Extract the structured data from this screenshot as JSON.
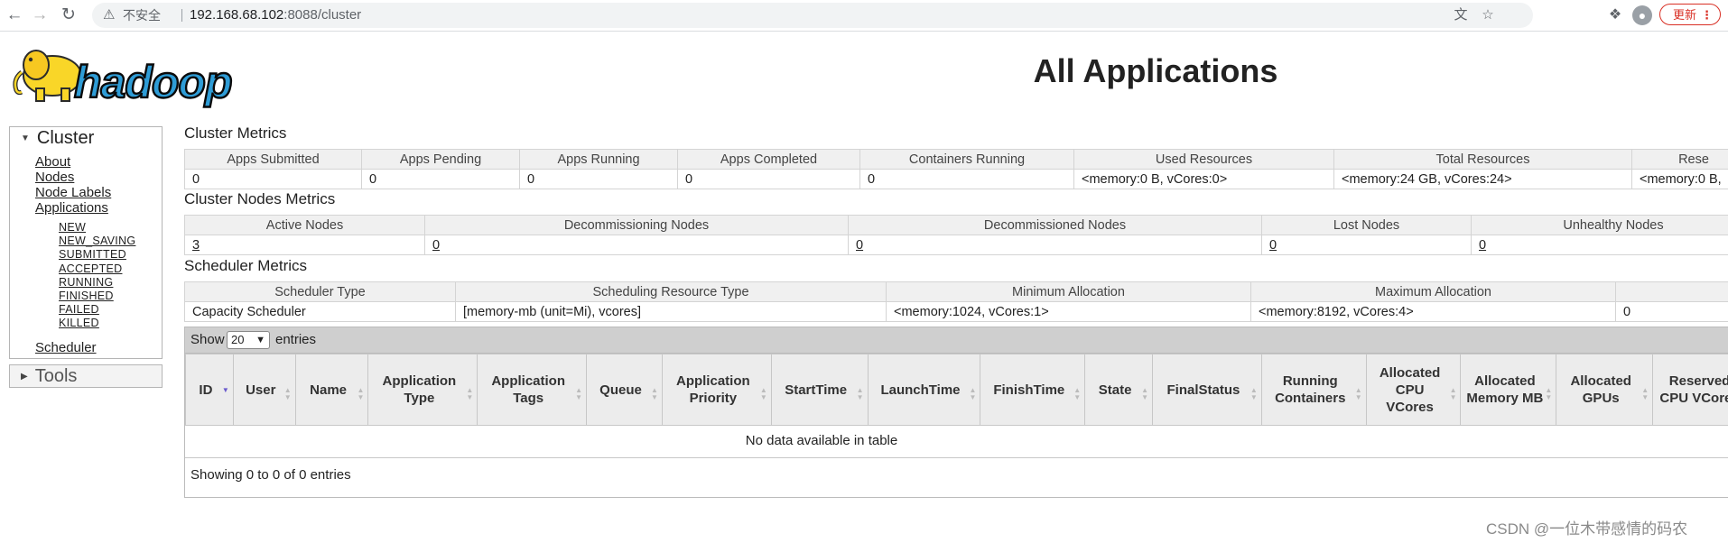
{
  "browser": {
    "security_label": "不安全",
    "url_host": "192.168.68.102",
    "url_rest": ":8088/cluster",
    "update_label": "更新"
  },
  "header": {
    "logo_text": "hadoop",
    "title": "All Applications"
  },
  "sidebar": {
    "cluster_label": "Cluster",
    "links": [
      "About",
      "Nodes",
      "Node Labels",
      "Applications"
    ],
    "app_states": [
      "NEW",
      "NEW_SAVING",
      "SUBMITTED",
      "ACCEPTED",
      "RUNNING",
      "FINISHED",
      "FAILED",
      "KILLED"
    ],
    "scheduler_label": "Scheduler",
    "tools_label": "Tools"
  },
  "cluster_metrics": {
    "title": "Cluster Metrics",
    "headers": [
      "Apps Submitted",
      "Apps Pending",
      "Apps Running",
      "Apps Completed",
      "Containers Running",
      "Used Resources",
      "Total Resources",
      "Rese"
    ],
    "values": [
      "0",
      "0",
      "0",
      "0",
      "0",
      "<memory:0 B, vCores:0>",
      "<memory:24 GB, vCores:24>",
      "<memory:0 B,"
    ]
  },
  "nodes_metrics": {
    "title": "Cluster Nodes Metrics",
    "headers": [
      "Active Nodes",
      "Decommissioning Nodes",
      "Decommissioned Nodes",
      "Lost Nodes",
      "Unhealthy Nodes"
    ],
    "values": [
      "3",
      "0",
      "0",
      "0",
      "0"
    ]
  },
  "scheduler_metrics": {
    "title": "Scheduler Metrics",
    "headers": [
      "Scheduler Type",
      "Scheduling Resource Type",
      "Minimum Allocation",
      "Maximum Allocation",
      ""
    ],
    "values": [
      "Capacity Scheduler",
      "[memory-mb (unit=Mi), vcores]",
      "<memory:1024, vCores:1>",
      "<memory:8192, vCores:4>",
      "0"
    ]
  },
  "apps_table": {
    "show_label": "Show",
    "entries_value": "20",
    "entries_label": "entries",
    "columns": [
      "ID",
      "User",
      "Name",
      "Application Type",
      "Application Tags",
      "Queue",
      "Application Priority",
      "StartTime",
      "LaunchTime",
      "FinishTime",
      "State",
      "FinalStatus",
      "Running Containers",
      "Allocated CPU VCores",
      "Allocated Memory MB",
      "Allocated GPUs",
      "Reserved CPU VCores"
    ],
    "empty_message": "No data available in table",
    "info": "Showing 0 to 0 of 0 entries"
  },
  "watermark": "CSDN @一位木带感情的码农"
}
